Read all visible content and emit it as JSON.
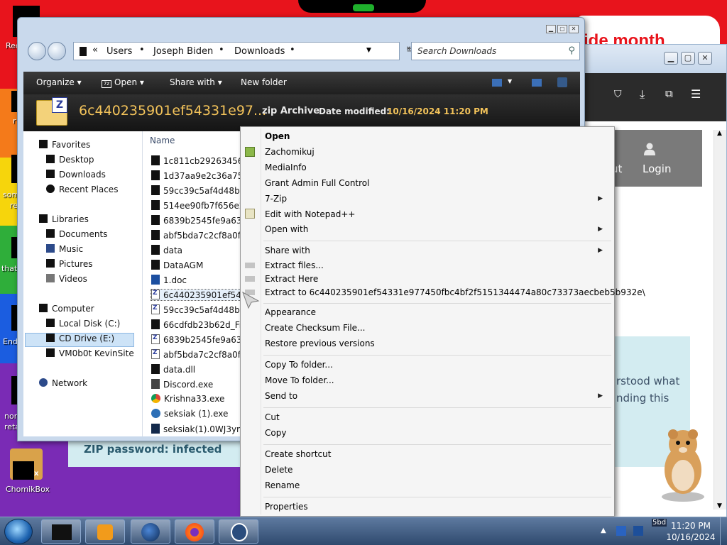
{
  "explorer": {
    "breadcrumb": [
      "Users",
      "Joseph Biden",
      "Downloads"
    ],
    "breadcrumb_prefix": "«",
    "search_placeholder": "Search Downloads",
    "toolbar": {
      "organize": "Organize",
      "open": "Open",
      "share_with": "Share with",
      "new_folder": "New folder"
    },
    "header": {
      "name": "6c440235901ef54331e97...",
      "type": "zip Archive",
      "date_label": "Date modified:",
      "date_value": "10/16/2024 11:20 PM"
    },
    "nav": {
      "favorites": "Favorites",
      "desktop": "Desktop",
      "downloads": "Downloads",
      "recent_places": "Recent Places",
      "libraries": "Libraries",
      "documents": "Documents",
      "music": "Music",
      "pictures": "Pictures",
      "videos": "Videos",
      "computer": "Computer",
      "local_disk": "Local Disk (C:)",
      "cd_drive": "CD Drive (E:)",
      "vm_site": "VM0b0t KevinSite",
      "network": "Network"
    },
    "column_name": "Name",
    "files": [
      "1c811cb29263456edf",
      "1d37aa9e2c36a75ada",
      "59cc39c5af4d48bd23",
      "514ee90fb7f656e2ba",
      "6839b2545fe9a6347b",
      "abf5bda7c2cf8a0f7b",
      "data",
      "DataAGM",
      "1.doc",
      "6c440235901ef54331",
      "59cc39c5af4d48bd23",
      "66cdfdb23b62d_File.",
      "6839b2545fe9a6347b",
      "abf5bda7c2cf8a0f7b",
      "data.dll",
      "Discord.exe",
      "Krishna33.exe",
      "seksiak (1).exe",
      "seksiak(1).0WJ3ym52"
    ]
  },
  "context_menu": {
    "open": "Open",
    "zachomikuj": "Zachomikuj",
    "mediainfo": "MediaInfo",
    "grant_admin": "Grant Admin Full Control",
    "sevenzip": "7-Zip",
    "edit_notepad": "Edit with Notepad++",
    "open_with": "Open with",
    "share_with": "Share with",
    "extract_files": "Extract files...",
    "extract_here": "Extract Here",
    "extract_to": "Extract to 6c440235901ef54331e977450fbc4bf2f5151344474a80c73373aecbeb5b932e\\",
    "appearance": "Appearance",
    "create_checksum": "Create Checksum File...",
    "restore_versions": "Restore previous versions",
    "copy_to_folder": "Copy To folder...",
    "move_to_folder": "Move To folder...",
    "send_to": "Send to",
    "cut": "Cut",
    "copy": "Copy",
    "create_shortcut": "Create shortcut",
    "delete": "Delete",
    "rename": "Rename",
    "properties": "Properties"
  },
  "browser": {
    "banner": "ide month",
    "nav_ut": "ut",
    "login": "Login",
    "text_line1": "rstood what",
    "text_line2": "nding this",
    "zip_password": "ZIP password: infected"
  },
  "desktop": {
    "chomikbox_label": "ChomikBox",
    "left_labels": [
      "Rec",
      "r",
      "som",
      "re",
      "that",
      "End",
      "nor",
      "reta"
    ]
  },
  "taskbar": {
    "time": "11:20 PM",
    "date": "10/16/2024",
    "tray_badge": "5bd"
  }
}
